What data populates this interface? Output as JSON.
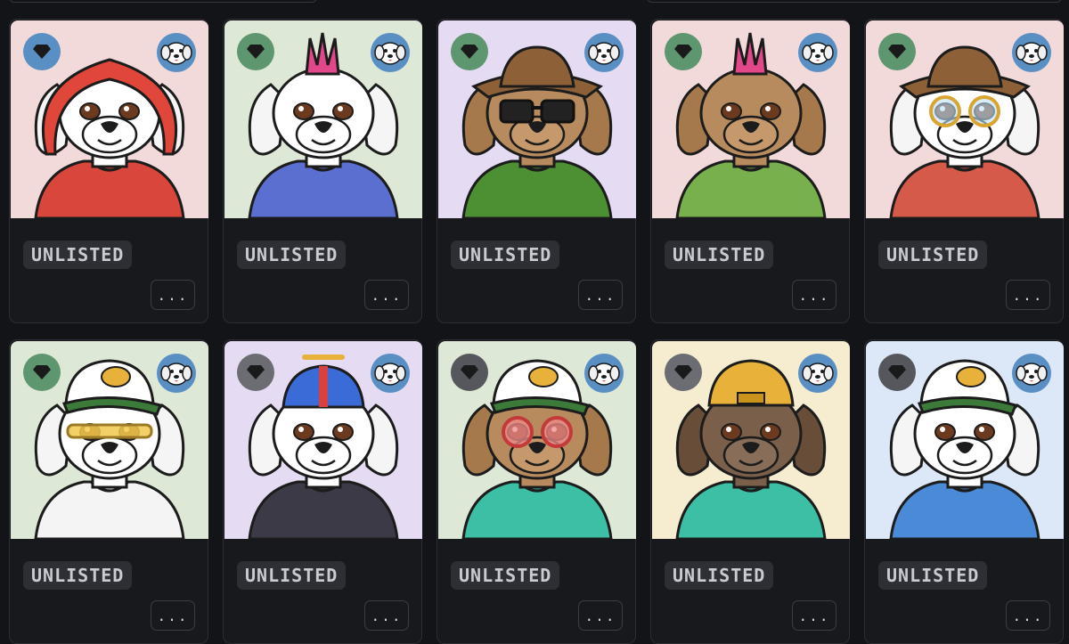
{
  "grid": {
    "cards": [
      {
        "status": "UNLISTED",
        "more_label": "...",
        "bg": "#f3dada",
        "rarity_color": "#5a8fc4",
        "fur": "#ffffff",
        "accent": "#e0463a",
        "outfit": "#d9463b",
        "headwear": "hood",
        "eyewear": "none"
      },
      {
        "status": "UNLISTED",
        "more_label": "...",
        "bg": "#dde8d6",
        "rarity_color": "#5e9670",
        "fur": "#ffffff",
        "accent": "#e2478a",
        "outfit": "#5b6fd1",
        "headwear": "mohawk",
        "eyewear": "none"
      },
      {
        "status": "UNLISTED",
        "more_label": "...",
        "bg": "#e5dcf3",
        "rarity_color": "#5e9670",
        "fur": "#b78b5e",
        "accent": "#8d6038",
        "outfit": "#4d8f33",
        "headwear": "bucket-hat",
        "eyewear": "sunglasses"
      },
      {
        "status": "UNLISTED",
        "more_label": "...",
        "bg": "#f3dada",
        "rarity_color": "#5e9670",
        "fur": "#b78b5e",
        "accent": "#e2478a",
        "outfit": "#78b04d",
        "headwear": "mohawk",
        "eyewear": "none"
      },
      {
        "status": "UNLISTED",
        "more_label": "...",
        "bg": "#f3dada",
        "rarity_color": "#5e9670",
        "fur": "#ffffff",
        "accent": "#8d6038",
        "outfit": "#d65a4a",
        "headwear": "bucket-hat",
        "eyewear": "round-glasses"
      },
      {
        "status": "UNLISTED",
        "more_label": "...",
        "bg": "#dde8d6",
        "rarity_color": "#5e9670",
        "fur": "#ffffff",
        "accent": "#3c7a3a",
        "outfit": "#f4f4f4",
        "headwear": "trucker-cap",
        "eyewear": "yellow-shades"
      },
      {
        "status": "UNLISTED",
        "more_label": "...",
        "bg": "#e5dcf3",
        "rarity_color": "#6b6d72",
        "fur": "#ffffff",
        "accent": "#3b6bd6",
        "outfit": "#3c3a46",
        "headwear": "propeller-cap",
        "eyewear": "none"
      },
      {
        "status": "UNLISTED",
        "more_label": "...",
        "bg": "#dde8d6",
        "rarity_color": "#55575c",
        "fur": "#b78b5e",
        "accent": "#3c7a3a",
        "outfit": "#3cbfa4",
        "headwear": "trucker-cap",
        "eyewear": "red-glasses"
      },
      {
        "status": "UNLISTED",
        "more_label": "...",
        "bg": "#f6edd0",
        "rarity_color": "#6b6d72",
        "fur": "#7a5f4a",
        "accent": "#e8b23a",
        "outfit": "#3cbfa4",
        "headwear": "backwards-cap",
        "eyewear": "none"
      },
      {
        "status": "UNLISTED",
        "more_label": "...",
        "bg": "#dce8f8",
        "rarity_color": "#55575c",
        "fur": "#ffffff",
        "accent": "#3c7a3a",
        "outfit": "#4a8ad6",
        "headwear": "trucker-cap",
        "eyewear": "none"
      }
    ],
    "icons": {
      "rarity": "diamond-icon",
      "collection": "dog-logo-icon",
      "more": "ellipsis-icon"
    }
  }
}
